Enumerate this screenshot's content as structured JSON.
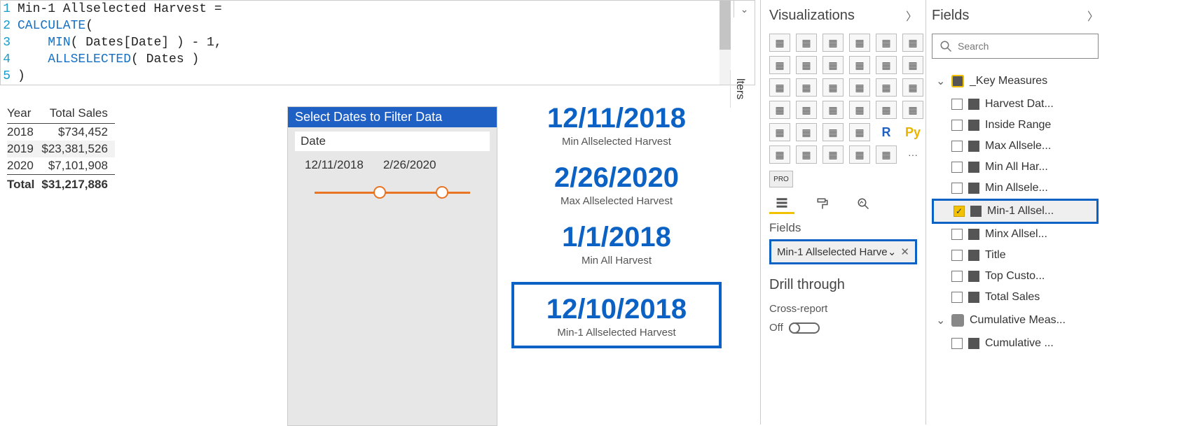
{
  "formula": {
    "lines": [
      {
        "n": "1",
        "parts": [
          {
            "t": "Min-1 Allselected Harvest = ",
            "c": "tok-plain"
          }
        ]
      },
      {
        "n": "2",
        "parts": [
          {
            "t": "CALCULATE",
            "c": "tok-fn"
          },
          {
            "t": "(",
            "c": "tok-plain"
          }
        ]
      },
      {
        "n": "3",
        "parts": [
          {
            "t": "    ",
            "c": "tok-plain"
          },
          {
            "t": "MIN",
            "c": "tok-fn"
          },
          {
            "t": "( Dates[Date] ) - 1,",
            "c": "tok-plain"
          }
        ]
      },
      {
        "n": "4",
        "parts": [
          {
            "t": "    ",
            "c": "tok-plain"
          },
          {
            "t": "ALLSELECTED",
            "c": "tok-fn"
          },
          {
            "t": "( Dates )",
            "c": "tok-plain"
          }
        ]
      },
      {
        "n": "5",
        "parts": [
          {
            "t": ")",
            "c": "tok-plain"
          }
        ]
      }
    ]
  },
  "sales_table": {
    "col1": "Year",
    "col2": "Total Sales",
    "rows": [
      {
        "year": "2018",
        "total": "$734,452",
        "alt": false
      },
      {
        "year": "2019",
        "total": "$23,381,526",
        "alt": true
      },
      {
        "year": "2020",
        "total": "$7,101,908",
        "alt": false
      }
    ],
    "total_label": "Total",
    "total_value": "$31,217,886"
  },
  "slicer": {
    "title": "Select Dates to Filter Data",
    "field": "Date",
    "start": "12/11/2018",
    "end": "2/26/2020"
  },
  "cards": [
    {
      "value": "12/11/2018",
      "label": "Min Allselected Harvest",
      "boxed": false
    },
    {
      "value": "2/26/2020",
      "label": "Max Allselected Harvest",
      "boxed": false
    },
    {
      "value": "1/1/2018",
      "label": "Min All Harvest",
      "boxed": false
    },
    {
      "value": "12/10/2018",
      "label": "Min-1 Allselected Harvest",
      "boxed": true
    }
  ],
  "filters_tab": "lters",
  "viz": {
    "title": "Visualizations",
    "fields_label": "Fields",
    "well_value": "Min-1 Allselected Harve",
    "drill_title": "Drill through",
    "cross_report": "Cross-report",
    "toggle_label": "Off",
    "pro_label": "PRO"
  },
  "viz_icons": [
    "stacked-bar",
    "clustered-bar",
    "stacked-column",
    "clustered-column",
    "stacked-bar-100",
    "clustered-column-100",
    "line",
    "area",
    "stacked-area",
    "line-clustered",
    "line-stacked",
    "ribbon",
    "waterfall",
    "funnel",
    "scatter",
    "pie",
    "donut",
    "treemap",
    "map",
    "filled-map",
    "shape-map",
    "gauge",
    "card",
    "multi-row-card",
    "kpi",
    "slicer",
    "table",
    "matrix",
    "r-visual",
    "python-visual",
    "key-influencers",
    "decomposition",
    "qa",
    "paginated",
    "more-visuals",
    "ellipsis"
  ],
  "fields": {
    "title": "Fields",
    "search_placeholder": "Search",
    "groups": [
      {
        "name": "_Key Measures",
        "expanded": true,
        "icon": "key",
        "items": [
          {
            "label": "Harvest Dat...",
            "checked": false,
            "selected": false
          },
          {
            "label": "Inside Range",
            "checked": false,
            "selected": false
          },
          {
            "label": "Max Allsele...",
            "checked": false,
            "selected": false
          },
          {
            "label": "Min All Har...",
            "checked": false,
            "selected": false
          },
          {
            "label": "Min Allsele...",
            "checked": false,
            "selected": false
          },
          {
            "label": "Min-1 Allsel...",
            "checked": true,
            "selected": true
          },
          {
            "label": "Minx Allsel...",
            "checked": false,
            "selected": false
          },
          {
            "label": "Title",
            "checked": false,
            "selected": false
          },
          {
            "label": "Top Custo...",
            "checked": false,
            "selected": false
          },
          {
            "label": "Total Sales",
            "checked": false,
            "selected": false
          }
        ]
      },
      {
        "name": "Cumulative Meas...",
        "expanded": true,
        "icon": "table",
        "items": [
          {
            "label": "Cumulative ...",
            "checked": false,
            "selected": false
          }
        ]
      }
    ]
  }
}
